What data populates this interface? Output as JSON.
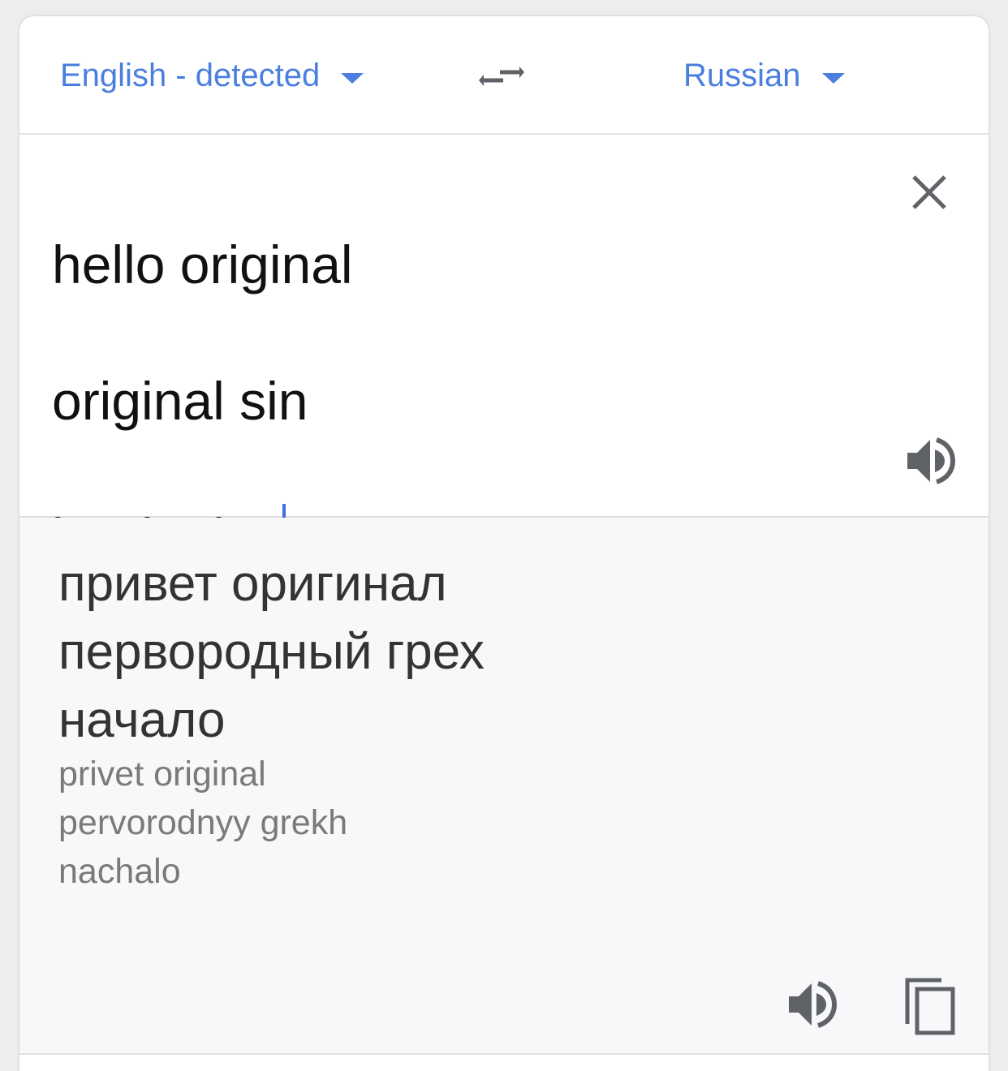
{
  "header": {
    "source_language": "English - detected",
    "target_language": "Russian"
  },
  "icons": {
    "swap": "swap-arrows-icon",
    "clear": "close-icon",
    "speak_source": "speaker-icon",
    "speak_target": "speaker-icon",
    "copy": "copy-icon"
  },
  "input": {
    "lines": [
      "hello original",
      "original sin",
      "beginning"
    ]
  },
  "output": {
    "translation_lines": [
      "привет оригинал",
      "первородный грех",
      "начало"
    ],
    "transliteration_lines": [
      "privet original",
      "pervorodnyy grekh",
      "nachalo"
    ]
  },
  "colors": {
    "accent": "#4a7fe0",
    "cursor": "#3f6fe0",
    "icon": "#5f6368",
    "output_bg": "#f8f8fa"
  }
}
